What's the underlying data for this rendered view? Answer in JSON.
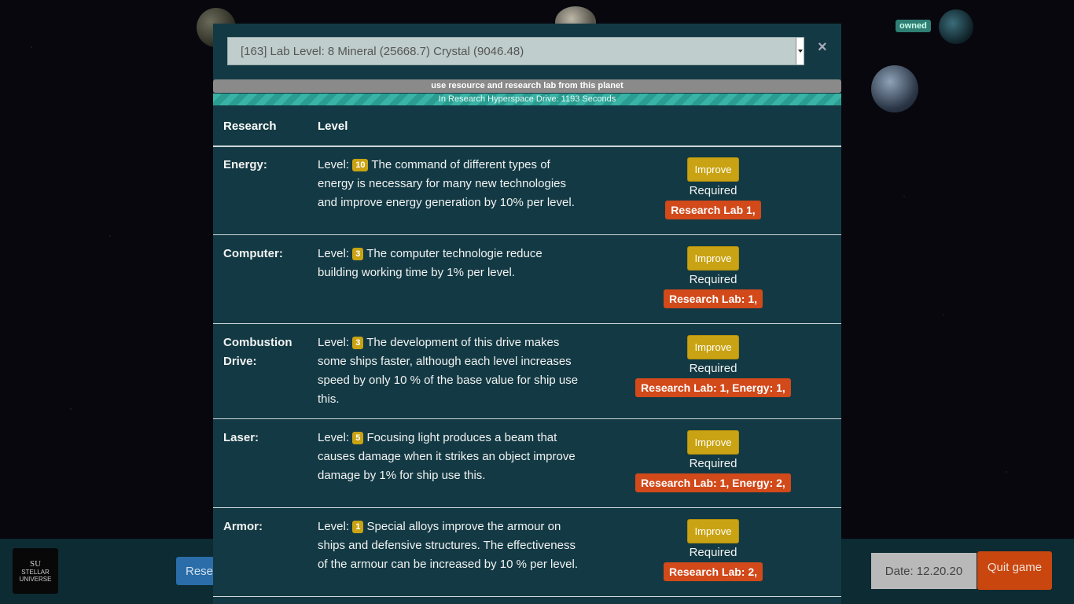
{
  "background": {
    "owned_label": "owned"
  },
  "bottom_bar": {
    "logo_big": "SU",
    "logo_small": "STELLAR UNIVERSE",
    "research_button": "Resea",
    "date": "Date: 12.20.20",
    "quit": "Quit game"
  },
  "modal": {
    "planet_select": "[163] Lab Level: 8 Mineral (25668.7) Crystal (9046.48)",
    "close": "×",
    "use_bar": "use resource and research lab from this planet",
    "progress_text": "In Research Hyperspace Drive: 1193 Seconds",
    "headers": {
      "research": "Research",
      "level": "Level"
    },
    "level_prefix": "Level:",
    "improve_label": "Improve",
    "required_label": "Required",
    "rows": [
      {
        "name": "Energy:",
        "level": "10",
        "desc": "The command of different types of energy is necessary for many new technologies and improve energy generation by 10% per level.",
        "requirement": "Research Lab 1,"
      },
      {
        "name": "Computer:",
        "level": "3",
        "desc": "The computer technologie reduce building working time by 1% per level.",
        "requirement": "Research Lab: 1,"
      },
      {
        "name": "Combustion Drive:",
        "level": "3",
        "desc": "The development of this drive makes some ships faster, although each level increases speed by only 10 % of the base value for ship use this.",
        "requirement": "Research Lab: 1, Energy: 1,"
      },
      {
        "name": "Laser:",
        "level": "5",
        "desc": "Focusing light produces a beam that causes damage when it strikes an object improve damage by 1% for ship use this.",
        "requirement": "Research Lab: 1, Energy: 2,"
      },
      {
        "name": "Armor:",
        "level": "1",
        "desc": "Special alloys improve the armour on ships and defensive structures. The effectiveness of the armour can be increased by 10 % per level.",
        "requirement": "Research Lab: 2,"
      }
    ]
  }
}
